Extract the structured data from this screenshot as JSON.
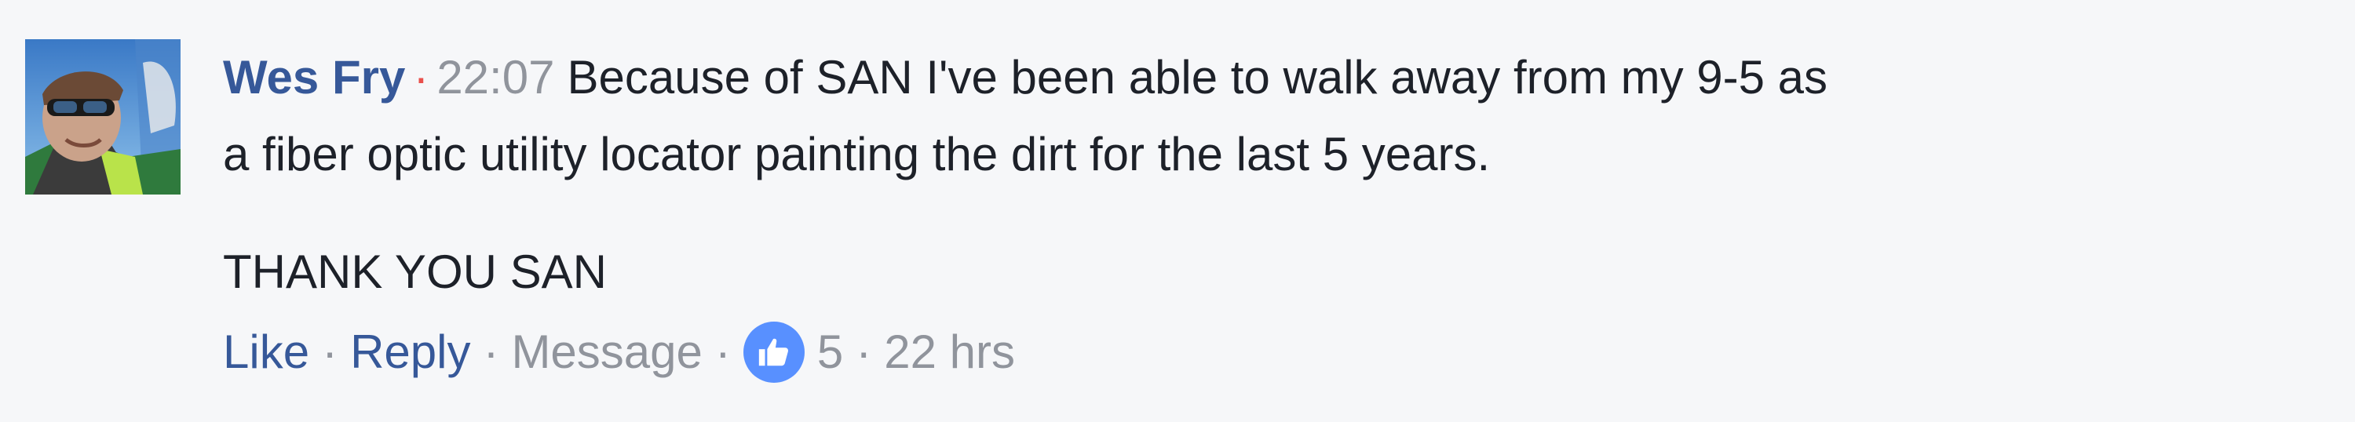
{
  "comment": {
    "author": "Wes Fry",
    "separator": "·",
    "time": "22:07",
    "text_line1": "Because of SAN I've been able to walk away from my 9-5 as",
    "text_line2": "a fiber optic utility locator painting the dirt for the last 5 years.",
    "text_para2": "THANK YOU SAN",
    "avatar_icon": "user-photo-avatar"
  },
  "actions": {
    "like_label": "Like",
    "reply_label": "Reply",
    "message_label": "Message",
    "dot": "·",
    "like_icon": "thumbs-up-icon",
    "like_count": "5",
    "age": "22 hrs"
  },
  "colors": {
    "author": "#365899",
    "link": "#365899",
    "muted": "#90949c",
    "dot_accent": "#e9504c",
    "like_badge": "#5890ff",
    "background": "#f6f7f9"
  }
}
